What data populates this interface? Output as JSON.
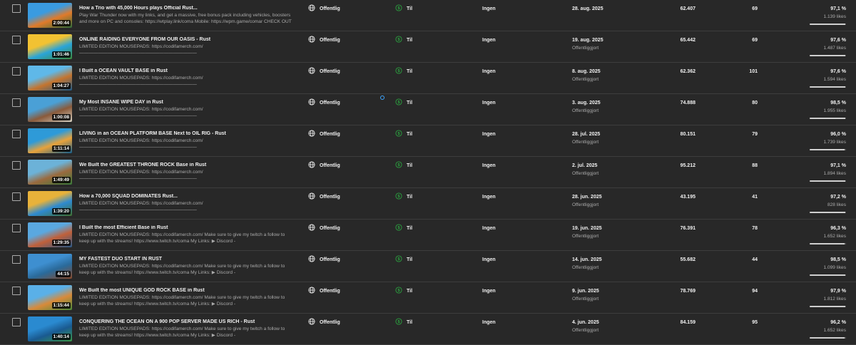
{
  "columns": {
    "visibility_icon": "globe-icon",
    "monetization_icon": "dollar-circle-icon",
    "monetization_color": "#2ba640"
  },
  "rows": [
    {
      "title": "How a Trio with 45,000 Hours plays Official Rust...",
      "description": "Play War Thunder now with my links, and get a massive, free bonus pack including vehicles, boosters and more on PC and consoles: https://wtplay.link/coma Mobile: https://wpm.game/comar CHECK OUT OUR...",
      "duration": "2:00:44",
      "visibility": "Offentlig",
      "monetization": "Til",
      "restrictions": "Ingen",
      "date": "28. aug. 2025",
      "date_status": "",
      "views": "62.407",
      "comments": "69",
      "likes_pct": "97,1 %",
      "likes_count": "1.139 likes",
      "likes_ratio": 0.971,
      "thumb_colors": [
        "#3a9be0",
        "#e07a2a",
        "#2f6d3a"
      ]
    },
    {
      "title": "ONLINE RAIDING EVERYONE FROM OUR OASIS - Rust",
      "description": "LIMITED EDITION MOUSEPADS: https://codifamerch.com/ —————————————————————————\n————————————— My Links: ▶ Discord - https://discord.gg/CrUAGGkfAV ▶ Twitter -",
      "duration": "1:01:46",
      "visibility": "Offentlig",
      "monetization": "Til",
      "restrictions": "Ingen",
      "date": "19. aug. 2025",
      "date_status": "Offentliggjort",
      "views": "65.442",
      "comments": "69",
      "likes_pct": "97,6 %",
      "likes_count": "1.487 likes",
      "likes_ratio": 0.976,
      "thumb_colors": [
        "#f2c232",
        "#2aa4d8",
        "#3c8a3a"
      ]
    },
    {
      "title": "I Built a OCEAN VAULT BASE in Rust",
      "description": "LIMITED EDITION MOUSEPADS: https://codifamerch.com/ —————————————————————————\n————————————— My Links: ▶ Discord - https://discord.gg/CrUAGGkfAV ▶ Twitter -",
      "duration": "1:04:27",
      "visibility": "Offentlig",
      "monetization": "Til",
      "restrictions": "Ingen",
      "date": "8. aug. 2025",
      "date_status": "Offentliggjort",
      "views": "62.362",
      "comments": "101",
      "likes_pct": "97,6 %",
      "likes_count": "1.594 likes",
      "likes_ratio": 0.976,
      "thumb_colors": [
        "#5fb8e8",
        "#c4742e",
        "#1f5c8a"
      ]
    },
    {
      "title": "My Most INSANE WIPE DAY in Rust",
      "description": "LIMITED EDITION MOUSEPADS: https://codifamerch.com/ —————————————————————————\n————————————— My Links: ▶ Discord - https://discord.gg/CrUAGGkfAV ▶ Twitter -",
      "duration": "1:00:08",
      "visibility": "Offentlig",
      "monetization": "Til",
      "restrictions": "Ingen",
      "date": "3. aug. 2025",
      "date_status": "Offentliggjort",
      "views": "74.888",
      "comments": "80",
      "likes_pct": "98,5 %",
      "likes_count": "1.955 likes",
      "likes_ratio": 0.985,
      "thumb_colors": [
        "#4aa0d6",
        "#8a5a3a",
        "#d8d2c4"
      ]
    },
    {
      "title": "LIVING in an OCEAN PLATFORM BASE Next to OIL RIG - Rust",
      "description": "LIMITED EDITION MOUSEPADS: https://codifamerch.com/ —————————————————————————\n————————————— My Links: ▶ Discord - https://discord.gg/CrUAGGkfAV ▶ Twitter -",
      "duration": "1:11:14",
      "visibility": "Offentlig",
      "monetization": "Til",
      "restrictions": "Ingen",
      "date": "28. jul. 2025",
      "date_status": "Offentliggjort",
      "views": "80.151",
      "comments": "79",
      "likes_pct": "96,0 %",
      "likes_count": "1.739 likes",
      "likes_ratio": 0.96,
      "thumb_colors": [
        "#2e9ad8",
        "#e8a23a",
        "#15608f"
      ]
    },
    {
      "title": "We Built the GREATEST THRONE ROCK Base in Rust",
      "description": "LIMITED EDITION MOUSEPADS: https://codifamerch.com/ —————————————————————————\n————————————— My Links: ▶ Discord - https://discord.gg/CrUAGGkfAV ▶ Twitter -",
      "duration": "1:49:49",
      "visibility": "Offentlig",
      "monetization": "Til",
      "restrictions": "Ingen",
      "date": "2. jul. 2025",
      "date_status": "Offentliggjort",
      "views": "95.212",
      "comments": "88",
      "likes_pct": "97,1 %",
      "likes_count": "1.894 likes",
      "likes_ratio": 0.971,
      "thumb_colors": [
        "#6cb2d8",
        "#9a6a3e",
        "#3a7a3a"
      ]
    },
    {
      "title": "How a 70,000 SQUAD DOMINATES Rust...",
      "description": "LIMITED EDITION MOUSEPADS: https://codifamerch.com/ —————————————————————————\n————————————— My Links: ▶ Discord - https://discord.gg/CrUAGGkfAV ▶ Twitter -",
      "duration": "1:39:20",
      "visibility": "Offentlig",
      "monetization": "Til",
      "restrictions": "Ingen",
      "date": "28. jun. 2025",
      "date_status": "Offentliggjort",
      "views": "43.195",
      "comments": "41",
      "likes_pct": "97,2 %",
      "likes_count": "828 likes",
      "likes_ratio": 0.972,
      "thumb_colors": [
        "#e8b23a",
        "#2e8ad0",
        "#3f6f2e"
      ]
    },
    {
      "title": "I Built the most Efficient Base in Rust",
      "description": "LIMITED EDITION MOUSEPADS: https://codifamerch.com/ Make sure to give my twitch a follow to keep up with the streams! https://www.twitch.tv/coma My Links: ▶ Discord - https://discord.gg/CrUAGGkfAV...",
      "duration": "1:29:35",
      "visibility": "Offentlig",
      "monetization": "Til",
      "restrictions": "Ingen",
      "date": "19. jun. 2025",
      "date_status": "Offentliggjort",
      "views": "76.391",
      "comments": "78",
      "likes_pct": "96,3 %",
      "likes_count": "1.652 likes",
      "likes_ratio": 0.963,
      "thumb_colors": [
        "#5aa8e0",
        "#c0603a",
        "#2a5a8a"
      ]
    },
    {
      "title": "MY FASTEST DUO START IN RUST",
      "description": "LIMITED EDITION MOUSEPADS: https://codifamerch.com/ Make sure to give my twitch a follow to keep up with the streams! https://www.twitch.tv/coma My Links: ▶ Discord - https://discord.gg/CrUAGGkfAV...",
      "duration": "44:15",
      "visibility": "Offentlig",
      "monetization": "Til",
      "restrictions": "Ingen",
      "date": "14. jun. 2025",
      "date_status": "Offentliggjort",
      "views": "55.682",
      "comments": "44",
      "likes_pct": "98,5 %",
      "likes_count": "1.099 likes",
      "likes_ratio": 0.985,
      "thumb_colors": [
        "#3e8fd0",
        "#2a6a9a",
        "#8a4a2a"
      ]
    },
    {
      "title": "We Built the most UNIQUE GOD ROCK BASE in Rust",
      "description": "LIMITED EDITION MOUSEPADS: https://codifamerch.com/ Make sure to give my twitch a follow to keep up with the streams! https://www.twitch.tv/coma My Links: ▶ Discord - https://discord.gg/CrUAGGkfAV...",
      "duration": "1:15:44",
      "visibility": "Offentlig",
      "monetization": "Til",
      "restrictions": "Ingen",
      "date": "9. jun. 2025",
      "date_status": "Offentliggjort",
      "views": "78.769",
      "comments": "94",
      "likes_pct": "97,9 %",
      "likes_count": "1.812 likes",
      "likes_ratio": 0.979,
      "thumb_colors": [
        "#5ab0e8",
        "#d88a3a",
        "#4a8a3a"
      ]
    },
    {
      "title": "CONQUERING THE OCEAN ON A 900 POP SERVER MADE US RICH - Rust",
      "description": "LIMITED EDITION MOUSEPADS: https://codifamerch.com/ Make sure to give my twitch a follow to keep up with the streams! https://www.twitch.tv/coma My Links: ▶ Discord - https://discord.gg/CrUAGGkfAV...",
      "duration": "1:40:14",
      "visibility": "Offentlig",
      "monetization": "Til",
      "restrictions": "Ingen",
      "date": "4. jun. 2025",
      "date_status": "Offentliggjort",
      "views": "84.159",
      "comments": "95",
      "likes_pct": "96,2 %",
      "likes_count": "1.652 likes",
      "likes_ratio": 0.962,
      "thumb_colors": [
        "#2a8ad0",
        "#1a5a90",
        "#3a9a4a"
      ]
    }
  ]
}
